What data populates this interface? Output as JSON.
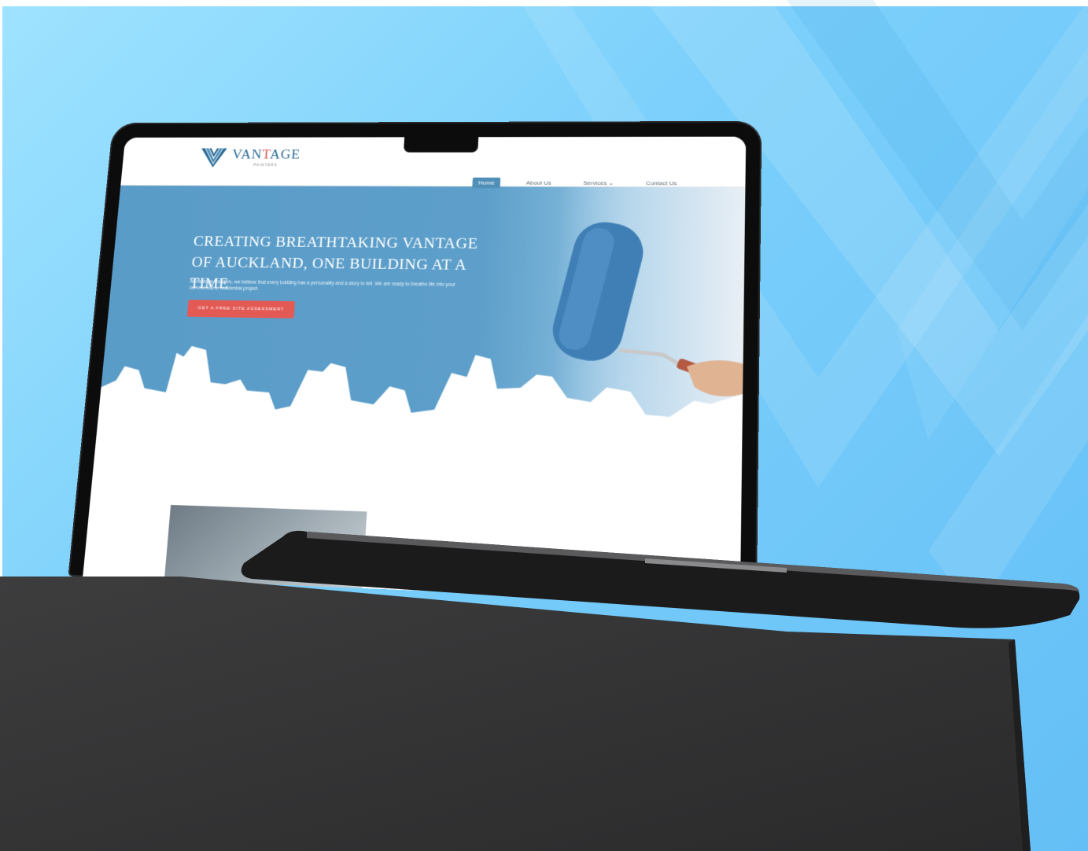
{
  "site": {
    "logo": {
      "word_prefix": "VAN",
      "word_accent": "T",
      "word_suffix": "AGE",
      "sub": "PAINTERS"
    },
    "nav": [
      {
        "label": "Home",
        "active": true
      },
      {
        "label": "About Us",
        "active": false
      },
      {
        "label": "Services ⌄",
        "active": false
      },
      {
        "label": "Contact Us",
        "active": false
      }
    ],
    "hero": {
      "title_line1": "CREATING BREATHTAKING VANTAGE",
      "title_line2": "OF AUCKLAND, ONE BUILDING AT A TIME",
      "text": "At Vantage Painters, we believe that every building has a personality and a story to tell. We are ready to breathe life into your commercial or residential project.",
      "cta": "GET A FREE SITE ASSESSMENT"
    }
  },
  "colors": {
    "background": "#7cd0fb",
    "hero_blue": "#5a9cc8",
    "cta_red": "#e35a55",
    "logo_blue": "#2b6a96",
    "laptop": "#0c0c0d",
    "concrete": "#3a3a3a"
  }
}
